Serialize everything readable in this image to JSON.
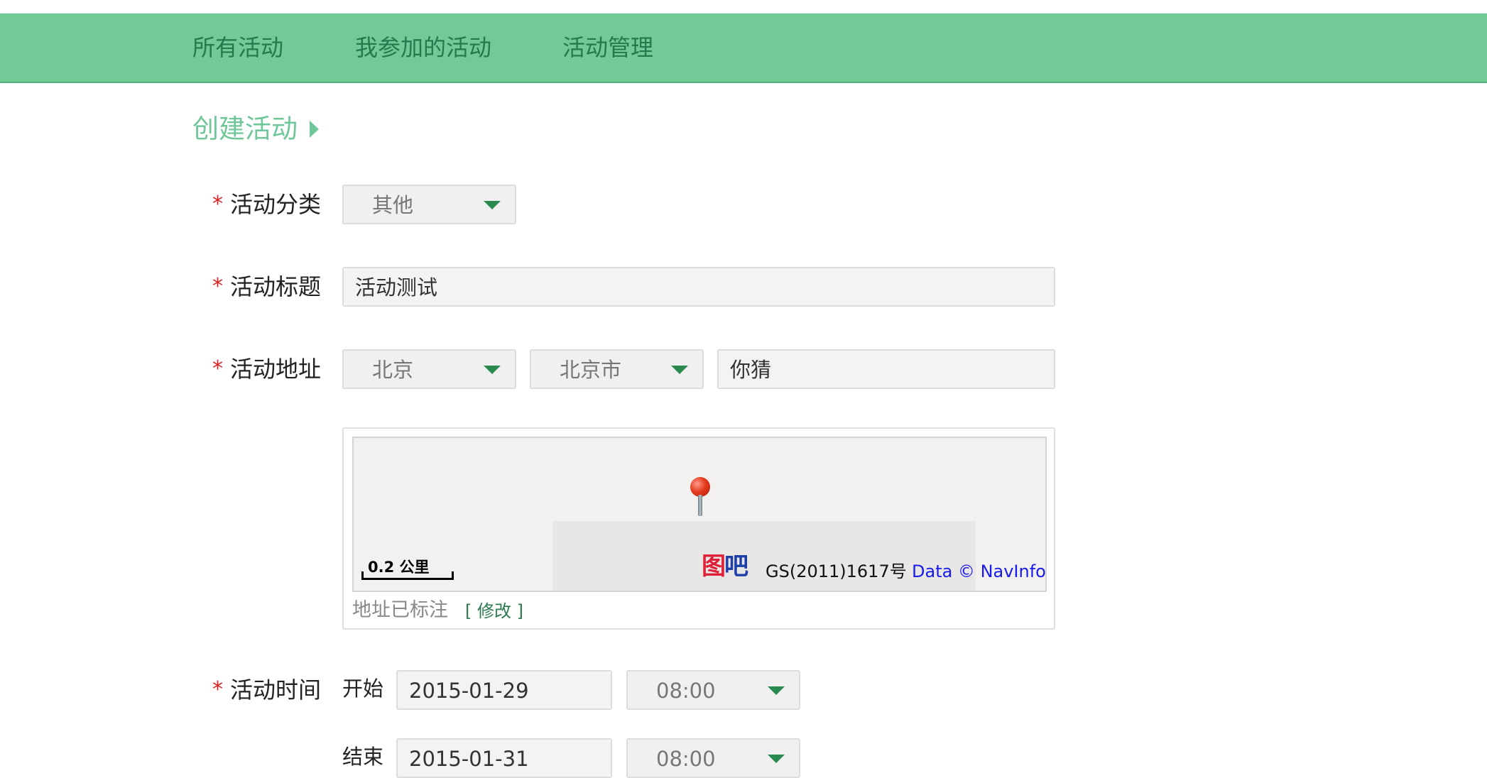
{
  "nav": {
    "items": [
      {
        "label": "所有活动"
      },
      {
        "label": "我参加的活动"
      },
      {
        "label": "活动管理"
      }
    ]
  },
  "section": {
    "title": "创建活动"
  },
  "form": {
    "required_mark": "*",
    "category": {
      "label": "活动分类",
      "value": "其他"
    },
    "title": {
      "label": "活动标题",
      "value": "活动测试"
    },
    "address": {
      "label": "活动地址",
      "province": "北京",
      "city": "北京市",
      "detail": "你猜"
    },
    "map": {
      "scale": "0.2 公里",
      "logo_part1": "图",
      "logo_part2": "吧",
      "license": "GS(2011)1617号",
      "data_credit": "Data © NavInfo",
      "status": "地址已标注",
      "edit_link": "[ 修改 ]"
    },
    "time": {
      "label": "活动时间",
      "start_label": "开始",
      "start_date": "2015-01-29",
      "start_time": "08:00",
      "end_label": "结束",
      "end_date": "2015-01-31",
      "end_time": "08:00"
    }
  },
  "colors": {
    "nav_bg": "#72ca97",
    "nav_text": "#237a4d",
    "accent": "#6fc699",
    "required": "#e02020",
    "caret": "#2a8a50",
    "map_link": "#1a1aee"
  }
}
